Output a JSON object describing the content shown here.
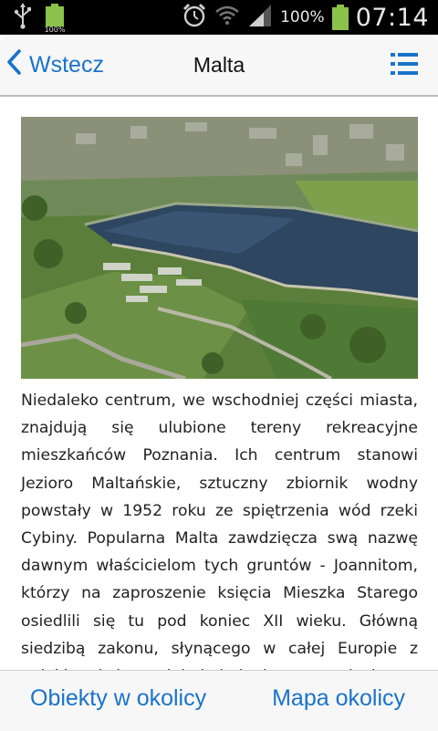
{
  "status_bar": {
    "battery_icon_label": "100%",
    "battery_percent": "100%",
    "time": "07:14",
    "icons": [
      "usb-icon",
      "battery-full-icon",
      "alarm-icon",
      "wifi-icon",
      "signal-icon",
      "battery-charging-icon"
    ],
    "battery_color": "#8bc34a"
  },
  "header": {
    "back_label": "Wstecz",
    "title": "Malta",
    "back_icon": "chevron-left-icon",
    "menu_icon": "list-icon",
    "accent_color": "#1a73c9"
  },
  "content": {
    "image_description_icon": "aerial-photo-lake-icon",
    "body": "Niedaleko centrum, we wschodniej części miasta, znajdują się ulubione tereny rekreacyjne mieszkańców Poznania. Ich centrum stanowi Jezioro Maltańskie, sztuczny zbiornik wodny powstały w 1952 roku ze spiętrzenia wód rzeki Cybiny. Popularna Malta zawdzięcza swą nazwę dawnym właścicielom tych gruntów - Joannitom, którzy na zaproszenie księcia Mieszka Starego osiedlili się tu pod koniec XII wieku. Główną siedzibą zakonu, słynącego w całej Europie z opieki nad chorymi, była jednak przez stulecia"
  },
  "bottom_bar": {
    "nearby_label": "Obiekty w okolicy",
    "map_label": "Mapa okolicy"
  }
}
